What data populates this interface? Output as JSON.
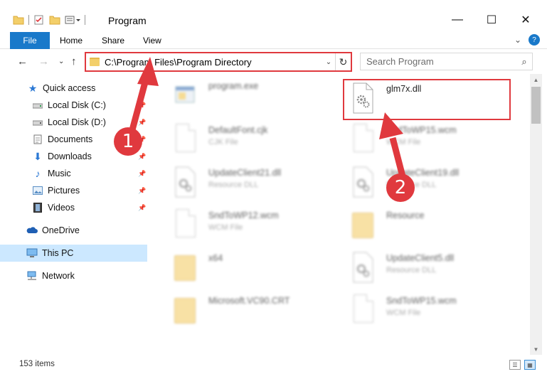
{
  "window": {
    "title": "Program",
    "minimize_glyph": "—",
    "maximize_glyph": "☐",
    "close_glyph": "✕"
  },
  "ribbon": {
    "tabs": [
      "File",
      "Home",
      "Share",
      "View"
    ]
  },
  "address_bar": {
    "path": "C:\\Program Files\\Program Directory"
  },
  "search": {
    "placeholder": "Search Program"
  },
  "sidebar": {
    "items": [
      {
        "label": "Quick access",
        "icon": "star-icon",
        "pinned": false
      },
      {
        "label": "Local Disk (C:)",
        "icon": "drive-icon",
        "pinned": true
      },
      {
        "label": "Local Disk (D:)",
        "icon": "drive-icon",
        "pinned": true
      },
      {
        "label": "Documents",
        "icon": "documents-icon",
        "pinned": true
      },
      {
        "label": "Downloads",
        "icon": "download-icon",
        "pinned": true
      },
      {
        "label": "Music",
        "icon": "music-icon",
        "pinned": true
      },
      {
        "label": "Pictures",
        "icon": "pictures-icon",
        "pinned": true
      },
      {
        "label": "Videos",
        "icon": "videos-icon",
        "pinned": true
      },
      {
        "label": "OneDrive",
        "icon": "cloud-icon",
        "pinned": false
      },
      {
        "label": "This PC",
        "icon": "computer-icon",
        "pinned": false,
        "selected": true
      },
      {
        "label": "Network",
        "icon": "network-icon",
        "pinned": false
      }
    ]
  },
  "files": [
    {
      "name": "program.exe",
      "type": "",
      "icon": "exe-icon"
    },
    {
      "name": "glm7x.dll",
      "type": "",
      "icon": "dll-icon"
    },
    {
      "name": "DefaultFont.cjk",
      "type": "CJK File",
      "icon": "file-icon"
    },
    {
      "name": "SndToWP15.wcm",
      "type": "WCM File",
      "icon": "file-icon"
    },
    {
      "name": "UpdateClient21.dll",
      "type": "Resource DLL",
      "icon": "dll-icon"
    },
    {
      "name": "UpdateClient19.dll",
      "type": "Resource DLL",
      "icon": "dll-icon"
    },
    {
      "name": "SndToWP12.wcm",
      "type": "WCM File",
      "icon": "file-icon"
    },
    {
      "name": "Resource",
      "type": "",
      "icon": "folder-icon"
    },
    {
      "name": "x64",
      "type": "",
      "icon": "folder-icon"
    },
    {
      "name": "UpdateClient5.dll",
      "type": "Resource DLL",
      "icon": "dll-icon"
    },
    {
      "name": "Microsoft.VC90.CRT",
      "type": "",
      "icon": "folder-icon"
    },
    {
      "name": "SndToWP15.wcm",
      "type": "WCM File",
      "icon": "file-icon"
    }
  ],
  "status": {
    "item_count": "153 items"
  },
  "annotations": {
    "step1": "1",
    "step2": "2",
    "color": "#e0393e"
  }
}
